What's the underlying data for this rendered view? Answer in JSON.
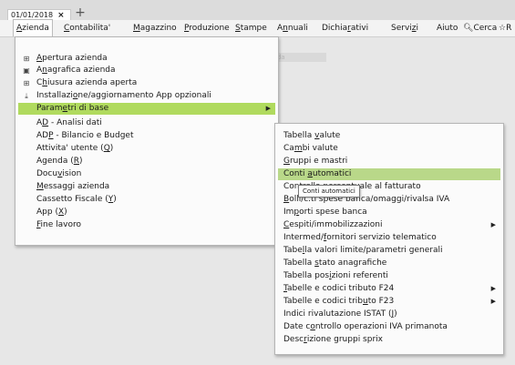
{
  "tab": {
    "title": "01/01/2018",
    "close": "×",
    "new": "+"
  },
  "menubar": [
    {
      "label": "Azienda",
      "key": "A",
      "rest": "zienda"
    },
    {
      "label": "Contabilita'",
      "key": "C",
      "rest": "ontabilita'"
    },
    {
      "label": "Magazzino",
      "key": "M",
      "rest": "agazzino"
    },
    {
      "label": "Produzione",
      "key": "P",
      "rest": "roduzione"
    },
    {
      "label": "Stampe",
      "key": "S",
      "rest": "tampe"
    },
    {
      "label": "Annuali",
      "pre": "A",
      "key": "n",
      "rest": "nuali"
    },
    {
      "label": "Dichiarativi",
      "pre": "Dichia",
      "key": "r",
      "rest": "ativi"
    },
    {
      "label": "Servizi",
      "pre": "Servi",
      "key": "z",
      "rest": "i"
    },
    {
      "label": "Aiuto",
      "pre": "Aiuto",
      "key": "",
      "rest": ""
    },
    {
      "label": "Cerca",
      "icon": "search-icon"
    },
    {
      "label": "R",
      "icon": "star-icon"
    }
  ],
  "ghost_text": "ida",
  "azienda_menu": [
    {
      "pre": "",
      "key": "A",
      "rest": "pertura azienda",
      "icon": "⊞"
    },
    {
      "pre": "A",
      "key": "n",
      "rest": "agrafica azienda",
      "icon": "▣"
    },
    {
      "pre": "C",
      "key": "h",
      "rest": "iusura azienda aperta",
      "icon": "⊞"
    },
    {
      "pre": "Installazi",
      "key": "o",
      "rest": "ne/aggiornamento App opzionali",
      "icon": "⤓"
    },
    {
      "pre": "Param",
      "key": "e",
      "rest": "tri di base",
      "arrow": "▶"
    },
    {
      "pre": "A",
      "key": "D",
      "rest": " - Analisi dati"
    },
    {
      "pre": "AD",
      "key": "P",
      "rest": " - Bilancio e Budget"
    },
    {
      "pre": "Attivita' utente (",
      "key": "Q",
      "rest": ")"
    },
    {
      "pre": "Agenda (",
      "key": "R",
      "rest": ")"
    },
    {
      "pre": "Docu",
      "key": "v",
      "rest": "ision"
    },
    {
      "pre": "",
      "key": "M",
      "rest": "essaggi azienda"
    },
    {
      "pre": "Cassetto Fiscale (",
      "key": "Y",
      "rest": ")"
    },
    {
      "pre": "App (",
      "key": "X",
      "rest": ")"
    },
    {
      "pre": "",
      "key": "F",
      "rest": "ine lavoro"
    }
  ],
  "parametri_menu": [
    {
      "pre": "Tabella ",
      "key": "v",
      "rest": "alute"
    },
    {
      "pre": "Ca",
      "key": "m",
      "rest": "bi valute"
    },
    {
      "pre": "",
      "key": "G",
      "rest": "ruppi e mastri"
    },
    {
      "pre": "Conti ",
      "key": "a",
      "rest": "utomatici"
    },
    {
      "pre": "Control",
      "key": "",
      "rest": "lo percentuale al fatturato"
    },
    {
      "pre": "",
      "key": "B",
      "rest": "olli/c.ti spese banca/omaggi/rivalsa IVA"
    },
    {
      "pre": "Im",
      "key": "p",
      "rest": "orti spese banca"
    },
    {
      "pre": "",
      "key": "C",
      "rest": "espiti/immobilizzazioni",
      "arrow": "▶"
    },
    {
      "pre": "Intermed/",
      "key": "f",
      "rest": "ornitori servizio telematico"
    },
    {
      "pre": "Tabe",
      "key": "l",
      "rest": "la valori limite/parametri generali"
    },
    {
      "pre": "Tabella ",
      "key": "s",
      "rest": "tato anagrafiche"
    },
    {
      "pre": "Tabella pos",
      "key": "i",
      "rest": "zioni referenti"
    },
    {
      "pre": "",
      "key": "T",
      "rest": "abelle e codici tributo F24",
      "arrow": "▶"
    },
    {
      "pre": "Tabelle e codici trib",
      "key": "u",
      "rest": "to F23",
      "arrow": "▶"
    },
    {
      "pre": "Indici rivalutazione ISTAT (",
      "key": "J",
      "rest": ")"
    },
    {
      "pre": "Date c",
      "key": "o",
      "rest": "ntrollo operazioni IVA primanota"
    },
    {
      "pre": "Desc",
      "key": "r",
      "rest": "izione gruppi sprix"
    }
  ],
  "tooltip": "Conti automatici"
}
